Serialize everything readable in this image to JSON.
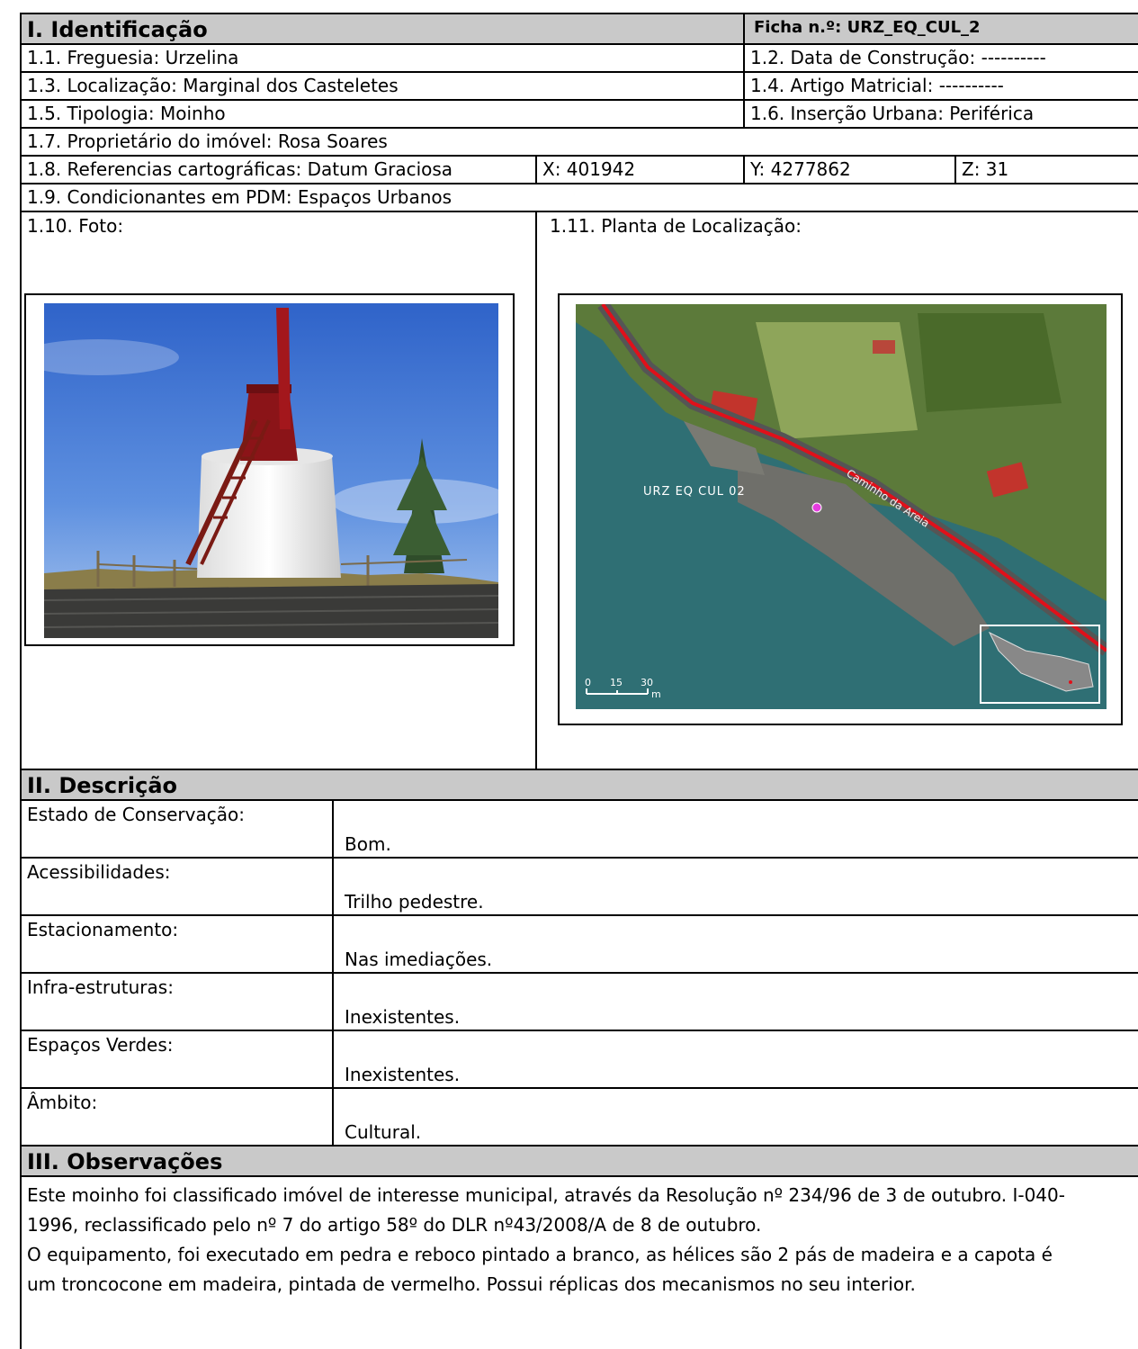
{
  "identificacao": {
    "title": "I. Identificação",
    "ficha": "Ficha n.º: URZ_EQ_CUL_2",
    "freguesia": "1.1. Freguesia: Urzelina",
    "data_construcao": "1.2. Data de Construção: ----------",
    "localizacao": "1.3. Localização: Marginal dos Casteletes",
    "artigo_matricial": "1.4. Artigo Matricial: ----------",
    "tipologia": "1.5. Tipologia: Moinho",
    "insercao_urbana": "1.6. Inserção Urbana: Periférica",
    "proprietario": "1.7. Proprietário do imóvel: Rosa Soares",
    "referencias": "1.8. Referencias cartográficas: Datum Graciosa",
    "coord_x": "X: 401942",
    "coord_y": "Y: 4277862",
    "coord_z": "Z: 31",
    "condicionantes": "1.9. Condicionantes em PDM: Espaços Urbanos",
    "foto_label": "1.10. Foto:",
    "planta_label": "1.11. Planta de Localização:",
    "map": {
      "site_label": "URZ EQ CUL 02",
      "road_label": "Caminho da Areia",
      "scale_ticks": [
        "0",
        "15",
        "30"
      ],
      "scale_unit": "m"
    }
  },
  "descricao": {
    "title": "II. Descrição",
    "rows": [
      {
        "label": "Estado de Conservação:",
        "value": "Bom."
      },
      {
        "label": "Acessibilidades:",
        "value": "Trilho pedestre."
      },
      {
        "label": "Estacionamento:",
        "value": "Nas imediações."
      },
      {
        "label": "Infra-estruturas:",
        "value": "Inexistentes."
      },
      {
        "label": "Espaços Verdes:",
        "value": "Inexistentes."
      },
      {
        "label": "Âmbito:",
        "value": "Cultural."
      }
    ]
  },
  "observacoes": {
    "title": "III. Observações",
    "paragraph1_line1": "Este moinho foi classificado imóvel de interesse municipal, através da Resolução nº 234/96 de 3 de outubro. I-040-",
    "paragraph1_line2": "1996, reclassificado pelo nº 7 do artigo 58º do DLR nº43/2008/A de 8 de outubro.",
    "paragraph2_line1": "O equipamento, foi executado em pedra e reboco pintado a branco, as hélices são 2 pás de madeira e a capota é",
    "paragraph2_line2": "um troncocone em madeira, pintada de vermelho. Possui réplicas dos mecanismos no seu interior."
  },
  "colors": {
    "header_bg": "#c9c9c9",
    "border": "#000000"
  }
}
